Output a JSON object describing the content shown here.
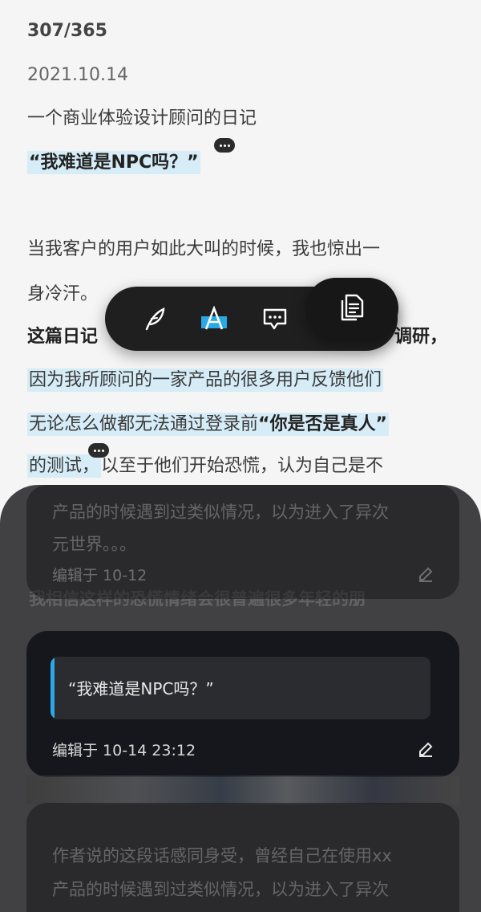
{
  "article": {
    "day_counter": "307/365",
    "date": "2021.10.14",
    "subtitle": "一个商业体验设计顾问的日记",
    "headline": "“我难道是NPC吗？”",
    "para1_line1": "当我客户的用户如此大叫的时候，我也惊出一",
    "para1_line2": "身冷汗。",
    "para2_start": "这篇日记",
    "para2_end": "调研，",
    "hl_line1": "因为我所顾问的一家产品的很多用户反馈他们",
    "hl_line2_a": "无论怎么做都无法通过登录前",
    "hl_line2_b": "“你是否是真人”",
    "line3_hl": "的测试，",
    "line3_rest": "以至于他们开始恐慌，认为自己是不",
    "behind_line": "我相信这样的恐慌情绪会很普遍很多年轻的朋"
  },
  "toolbar": {
    "tools": [
      {
        "name": "feather-icon"
      },
      {
        "name": "highlight-text-icon"
      },
      {
        "name": "comment-icon"
      },
      {
        "name": "copy-icon"
      }
    ],
    "accent": "#2aa8e8"
  },
  "notes": [
    {
      "text_line1": "产品的时候遇到过类似情况，以为进入了异次",
      "text_line2": "元世界。。。",
      "edited": "编辑于 10-12"
    },
    {
      "quote": "“我难道是NPC吗？”",
      "edited": "编辑于 10-14 23:12"
    },
    {
      "text_line1": "作者说的这段话感同身受，曾经自己在使用xx",
      "text_line2": "产品的时候遇到过类似情况，以为进入了异次"
    }
  ]
}
